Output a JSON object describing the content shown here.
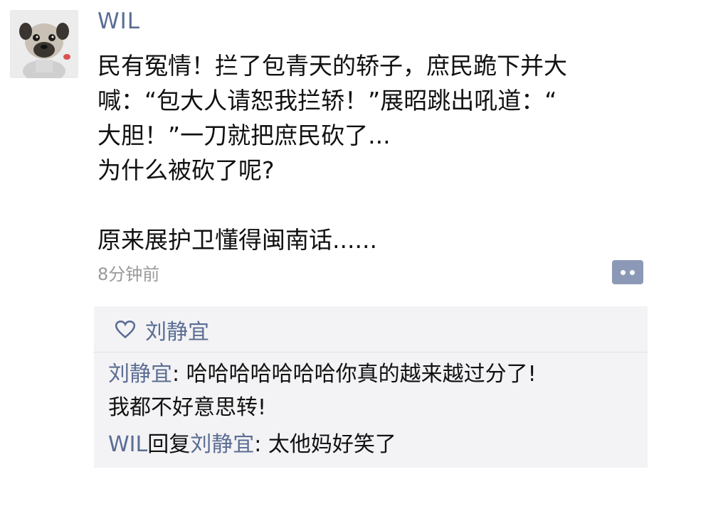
{
  "post": {
    "author": "WIL",
    "lines": [
      "民有冤情！拦了包青天的轿子，庶民跪下并大",
      "喊：“包大人请恕我拦轿！”展昭跳出吼道：“",
      "大胆！”一刀就把庶民砍了...",
      "为什么被砍了呢?"
    ],
    "punchline": "原来展护卫懂得闽南话......",
    "time": "8分钟前"
  },
  "likes": {
    "names": "刘静宜"
  },
  "comments": [
    {
      "name": "刘静宜",
      "separator": ": ",
      "text_line1": "哈哈哈哈哈哈哈你真的越来越过分了!",
      "text_line2": "我都不好意思转!"
    },
    {
      "name": "WIL",
      "reply_word": "回复",
      "reply_to": "刘静宜",
      "separator": ": ",
      "text": "太他妈好笑了"
    }
  ],
  "colors": {
    "name_link": "#5b6d94",
    "timestamp": "#9a9a9a",
    "comment_panel": "#f3f3f5",
    "comment_button": "#8c99b6"
  }
}
